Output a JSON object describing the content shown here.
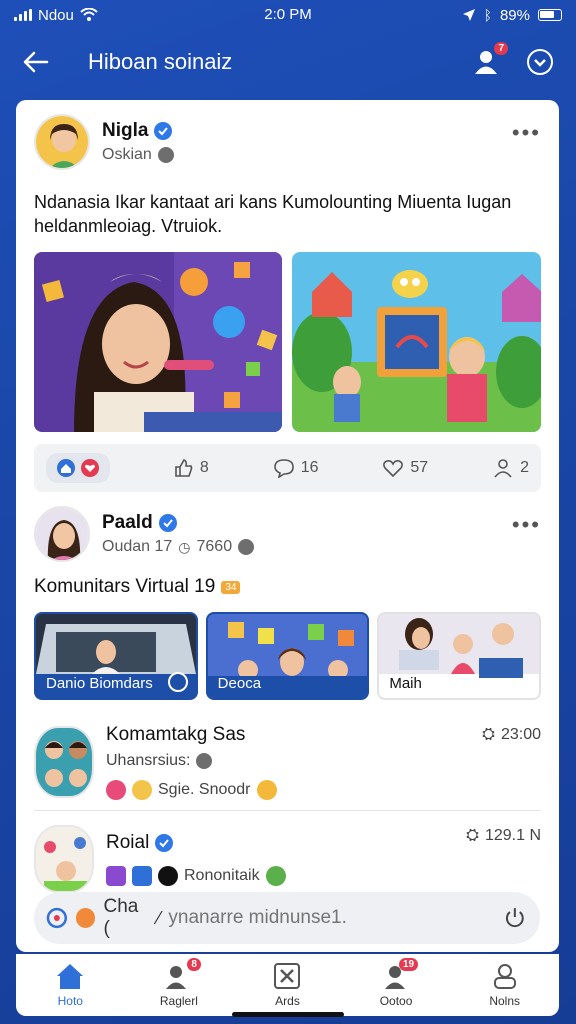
{
  "status": {
    "carrier": "Ndou",
    "time": "2:0 PM",
    "battery": "89%"
  },
  "appbar": {
    "title": "Hiboan soinaiz",
    "notif_badge": "7"
  },
  "post1": {
    "author": "Nigla",
    "subtitle": "Oskian",
    "text": "Ndanasia Ikar kantaat ari kans Kumolounting Miuenta Iugan heldanmleoiag. Vtruiok.",
    "likes": "8",
    "comments": "16",
    "hearts": "57",
    "shares": "2"
  },
  "post2": {
    "author": "Paald",
    "subtitle": "Oudan 17",
    "views": "7660",
    "community_title": "Komunitars Virtual 19",
    "community_tag": "34",
    "thumbs": [
      {
        "label": "Danio Biomdars"
      },
      {
        "label": "Deoca"
      },
      {
        "label": "Maih"
      }
    ]
  },
  "list": [
    {
      "title": "Komamtakg Sas",
      "sub": "Uhansrsius:",
      "extra": "Sgie. Snoodr",
      "time": "23:00"
    },
    {
      "title": "Roial",
      "sub": "Rononitaik",
      "time": "129.1 N"
    }
  ],
  "comment": {
    "prefix": "Cha (",
    "placeholder": "ynanarre midnunse1."
  },
  "nav": [
    {
      "label": "Hoto",
      "badge": ""
    },
    {
      "label": "Raglerl",
      "badge": "8"
    },
    {
      "label": "Ards",
      "badge": ""
    },
    {
      "label": "Ootoo",
      "badge": "19"
    },
    {
      "label": "Nolns",
      "badge": ""
    }
  ],
  "colors": {
    "accent": "#2f6fd8",
    "background": "#1e4fb8",
    "badge": "#e53950"
  }
}
